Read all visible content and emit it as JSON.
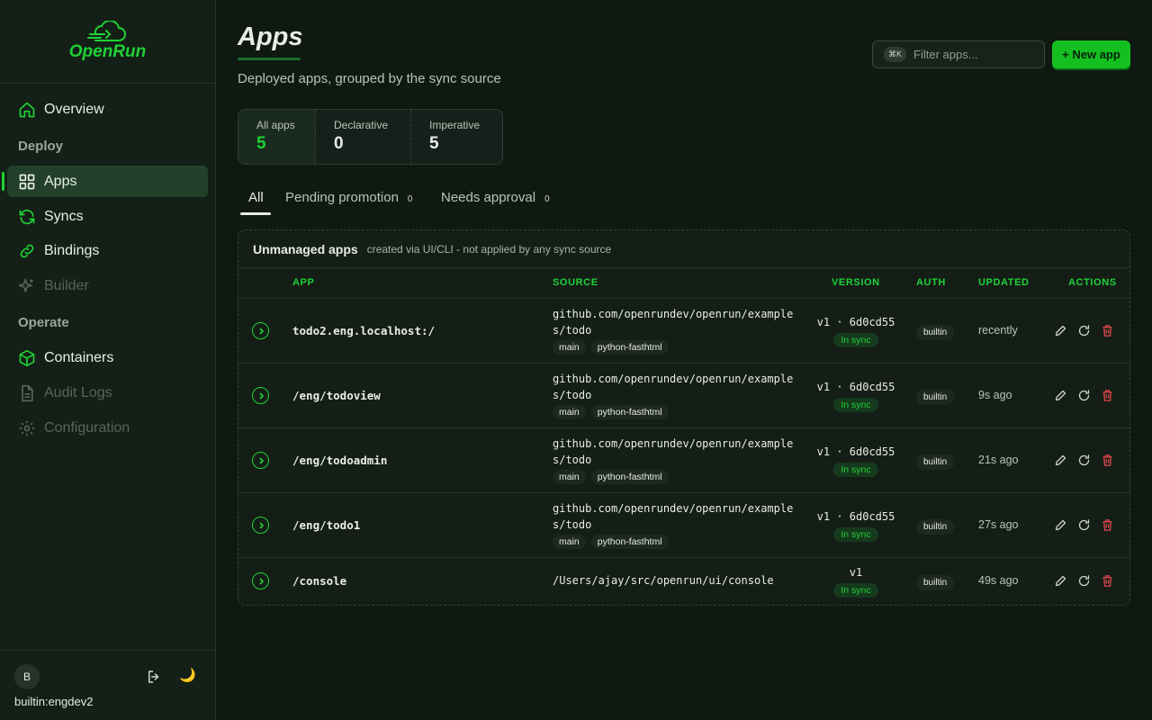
{
  "brand": {
    "name": "OpenRun"
  },
  "nav": {
    "overview": "Overview",
    "deploy_label": "Deploy",
    "apps": "Apps",
    "syncs": "Syncs",
    "bindings": "Bindings",
    "builder": "Builder",
    "operate_label": "Operate",
    "containers": "Containers",
    "audit_logs": "Audit Logs",
    "configuration": "Configuration"
  },
  "user": {
    "initial": "B",
    "name": "builtin:engdev2"
  },
  "page": {
    "title": "Apps",
    "subtitle": "Deployed apps, grouped by the sync source"
  },
  "search": {
    "shortcut": "⌘K",
    "placeholder": "Filter apps..."
  },
  "new_button": "+ New app",
  "stats": [
    {
      "label": "All apps",
      "value": "5"
    },
    {
      "label": "Declarative",
      "value": "0"
    },
    {
      "label": "Imperative",
      "value": "5"
    }
  ],
  "tabs": [
    {
      "label": "All"
    },
    {
      "label": "Pending promotion",
      "count": "0"
    },
    {
      "label": "Needs approval",
      "count": "0"
    }
  ],
  "panel": {
    "title": "Unmanaged apps",
    "desc": "created via UI/CLI - not applied by any sync source"
  },
  "columns": {
    "app": "APP",
    "source": "SOURCE",
    "version": "VERSION",
    "auth": "AUTH",
    "updated": "UPDATED",
    "actions": "ACTIONS"
  },
  "rows": [
    {
      "app": "todo2.eng.localhost:/",
      "source": "github.com/openrundev/openrun/examples/todo",
      "tags": [
        "main",
        "python-fasthtml"
      ],
      "version": "v1 · 6d0cd55",
      "sync": "In sync",
      "auth": "builtin",
      "updated": "recently"
    },
    {
      "app": "/eng/todoview",
      "source": "github.com/openrundev/openrun/examples/todo",
      "tags": [
        "main",
        "python-fasthtml"
      ],
      "version": "v1 · 6d0cd55",
      "sync": "In sync",
      "auth": "builtin",
      "updated": "9s ago"
    },
    {
      "app": "/eng/todoadmin",
      "source": "github.com/openrundev/openrun/examples/todo",
      "tags": [
        "main",
        "python-fasthtml"
      ],
      "version": "v1 · 6d0cd55",
      "sync": "In sync",
      "auth": "builtin",
      "updated": "21s ago"
    },
    {
      "app": "/eng/todo1",
      "source": "github.com/openrundev/openrun/examples/todo",
      "tags": [
        "main",
        "python-fasthtml"
      ],
      "version": "v1 · 6d0cd55",
      "sync": "In sync",
      "auth": "builtin",
      "updated": "27s ago"
    },
    {
      "app": "/console",
      "source": "/Users/ajay/src/openrun/ui/console",
      "tags": [],
      "version": "v1",
      "sync": "In sync",
      "auth": "builtin",
      "updated": "49s ago"
    }
  ],
  "colors": {
    "accent": "#1fd236",
    "danger": "#e5484d",
    "background": "#0f1811"
  }
}
